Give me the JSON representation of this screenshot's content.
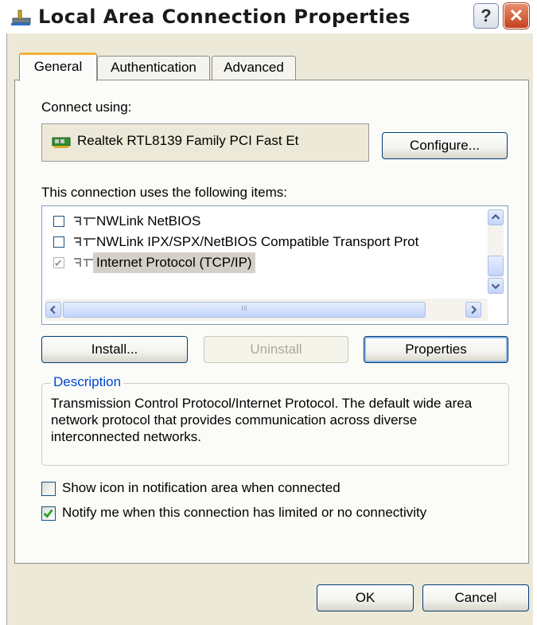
{
  "window": {
    "title": "Local Area Connection Properties",
    "help_label": "?",
    "close_label": "✕"
  },
  "tabs": [
    {
      "label": "General",
      "active": true
    },
    {
      "label": "Authentication",
      "active": false
    },
    {
      "label": "Advanced",
      "active": false
    }
  ],
  "connect": {
    "label": "Connect using:",
    "adapter": "Realtek RTL8139 Family PCI Fast Et",
    "configure_label": "Configure..."
  },
  "items": {
    "label": "This connection uses the following items:",
    "rows": [
      {
        "label": "NWLink NetBIOS",
        "checked": false
      },
      {
        "label": "NWLink IPX/SPX/NetBIOS Compatible Transport Prot",
        "checked": false
      },
      {
        "label": "Internet Protocol (TCP/IP)",
        "checked": true,
        "selected": true
      }
    ],
    "hscroll_grip": "III"
  },
  "buttons": {
    "install": "Install...",
    "uninstall": "Uninstall",
    "properties": "Properties"
  },
  "description": {
    "legend": "Description",
    "text": "Transmission Control Protocol/Internet Protocol. The default wide area network protocol that provides communication across diverse interconnected networks."
  },
  "options": [
    {
      "label": "Show icon in notification area when connected",
      "checked": false
    },
    {
      "label": "Notify me when this connection has limited or no connectivity",
      "checked": true
    }
  ],
  "footer": {
    "ok": "OK",
    "cancel": "Cancel"
  }
}
